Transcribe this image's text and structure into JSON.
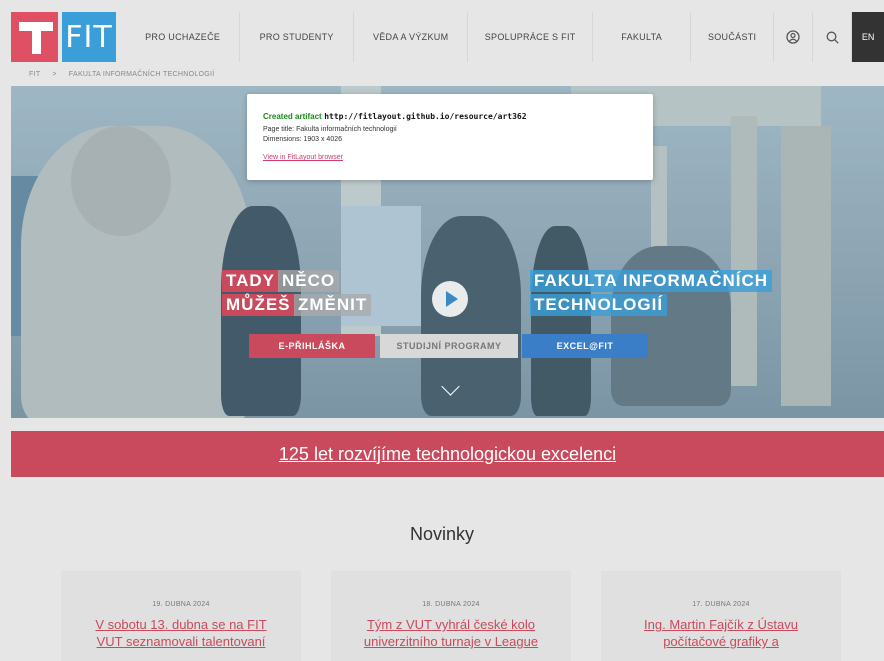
{
  "logo": {
    "text": "FIT"
  },
  "nav": {
    "items": [
      "PRO UCHAZEČE",
      "PRO STUDENTY",
      "VĚDA A VÝZKUM",
      "SPOLUPRÁCE S FIT",
      "FAKULTA",
      "SOUČÁSTI"
    ],
    "lang": "EN",
    "icons": [
      "user-icon",
      "search-icon"
    ]
  },
  "breadcrumb": {
    "items": [
      "FIT",
      ">",
      "FAKULTA INFORMAČNÍCH TECHNOLOGIÍ"
    ]
  },
  "hero": {
    "slogan": {
      "w1": "TADY",
      "w2": "NĚCO",
      "w3": "MŮŽEŠ",
      "w4": "ZMĚNIT"
    },
    "faculty_line1": "FAKULTA INFORMAČNÍCH",
    "faculty_line2": "TECHNOLOGIÍ",
    "cta": [
      "E-PŘIHLÁŠKA",
      "STUDIJNÍ PROGRAMY",
      "EXCEL@FIT"
    ]
  },
  "banner": {
    "text": "125 let rozvíjíme technologickou excelenci"
  },
  "news": {
    "title": "Novinky",
    "cards": [
      {
        "date": "19. DUBNA 2024",
        "line1": "V sobotu 13. dubna se na FIT",
        "line2": "VUT seznamovali talentovaní"
      },
      {
        "date": "18. DUBNA 2024",
        "line1": "Tým z VUT vyhrál české kolo",
        "line2": "univerzitního turnaje v League"
      },
      {
        "date": "17. DUBNA 2024",
        "line1": "Ing. Martin Fajčík z Ústavu",
        "line2": "počítačové grafiky a"
      }
    ]
  },
  "popup": {
    "created_label": "Created artifact",
    "url": "http://fitlayout.github.io/resource/art362",
    "page_title": "Page title: Fakulta informačních technologií",
    "dimensions": "Dimensions: 1903 x 4026",
    "link": "View in FitLayout browser"
  },
  "colors": {
    "accent_red": "#c84a5c",
    "logo_red": "#e05064",
    "logo_blue": "#3a9fd8",
    "cta_blue": "#3a7ec8"
  }
}
